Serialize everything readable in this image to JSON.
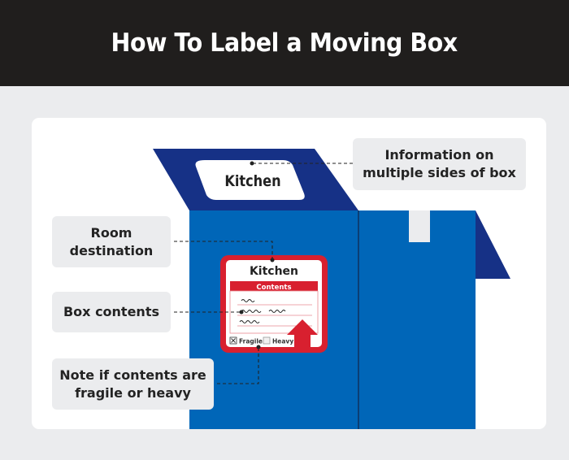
{
  "header": {
    "title": "How To Label a Moving Box"
  },
  "colors": {
    "header_bg": "#201e1d",
    "box_front": "#0066b8",
    "box_flap": "#163186",
    "label_red": "#d8202f",
    "callout_bg": "#ebecee"
  },
  "top_label": {
    "text": "Kitchen"
  },
  "front_label": {
    "room": "Kitchen",
    "contents_header": "Contents",
    "fragile_label": "Fragile",
    "fragile_checked": true,
    "heavy_label": "Heavy",
    "heavy_checked": false,
    "fragile_mark": "☒",
    "heavy_mark": "☐"
  },
  "callouts": [
    {
      "id": "multiple-sides",
      "line1": "Information on",
      "line2": "multiple sides of box"
    },
    {
      "id": "room-destination",
      "line1": "Room",
      "line2": "destination"
    },
    {
      "id": "box-contents",
      "line1": "Box contents",
      "line2": ""
    },
    {
      "id": "fragile-heavy",
      "line1": "Note if contents are",
      "line2": "fragile or heavy"
    }
  ]
}
